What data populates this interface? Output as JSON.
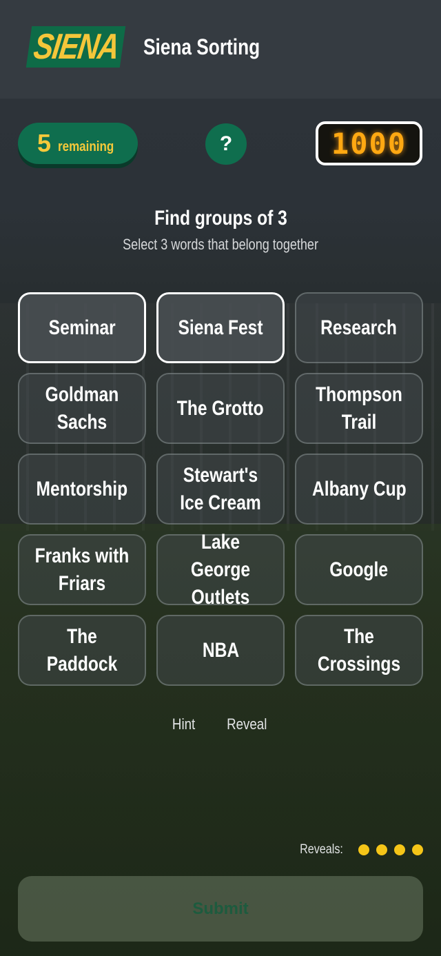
{
  "header": {
    "logo_text": "SIENA",
    "title": "Siena Sorting"
  },
  "status": {
    "remaining_count": "5",
    "remaining_label": "remaining",
    "help_label": "?",
    "score": "1000"
  },
  "instructions": {
    "title": "Find groups of 3",
    "subtitle": "Select 3 words that belong together"
  },
  "tiles": [
    {
      "label": "Seminar",
      "selected": true
    },
    {
      "label": "Siena Fest",
      "selected": true
    },
    {
      "label": "Research",
      "selected": false
    },
    {
      "label": "Goldman Sachs",
      "selected": false
    },
    {
      "label": "The Grotto",
      "selected": false
    },
    {
      "label": "Thompson Trail",
      "selected": false
    },
    {
      "label": "Mentorship",
      "selected": false
    },
    {
      "label": "Stewart's Ice Cream",
      "selected": false
    },
    {
      "label": "Albany Cup",
      "selected": false
    },
    {
      "label": "Franks with Friars",
      "selected": false
    },
    {
      "label": "Lake George Outlets",
      "selected": false
    },
    {
      "label": "Google",
      "selected": false
    },
    {
      "label": "The Paddock",
      "selected": false
    },
    {
      "label": "NBA",
      "selected": false
    },
    {
      "label": "The Crossings",
      "selected": false
    }
  ],
  "actions": {
    "hint_label": "Hint",
    "reveal_label": "Reveal"
  },
  "reveals": {
    "label": "Reveals:",
    "remaining": 4
  },
  "submit": {
    "label": "Submit"
  },
  "colors": {
    "brand_green": "#0f6e4e",
    "brand_gold": "#f5c93a",
    "score_orange": "#ffa812"
  }
}
